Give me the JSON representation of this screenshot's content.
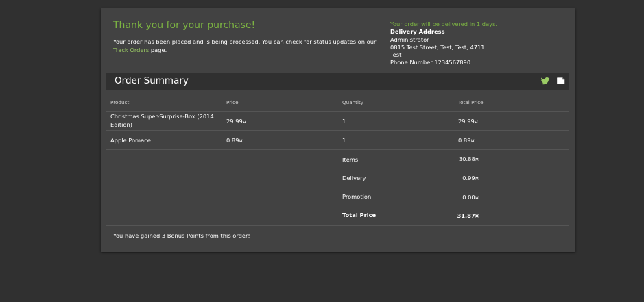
{
  "confirmation": {
    "title": "Thank you for your purchase!",
    "message_before": "Your order has been placed and is being processed. You can check for status updates on our ",
    "track_link": "Track Orders",
    "message_after": " page."
  },
  "delivery": {
    "eta": "Your order will be delivered in 1 days.",
    "address_title": "Delivery Address",
    "name": "Administrator",
    "street": "0815 Test Street, Test, Test, 4711",
    "country": "Test",
    "phone": "Phone Number 1234567890"
  },
  "summary": {
    "title": "Order Summary",
    "icons": [
      "twitter-icon",
      "print-icon"
    ],
    "colors": {
      "accent": "#7cb342",
      "link": "#9ccc65",
      "bar": "#303030",
      "card": "#424242"
    }
  },
  "table": {
    "headers": [
      "Product",
      "Price",
      "Quantity",
      "Total Price"
    ],
    "rows": [
      [
        "Christmas Super-Surprise-Box (2014 Edition)",
        "29.99¤",
        "1",
        "29.99¤"
      ],
      [
        "Apple Pomace",
        "0.89¤",
        "1",
        "0.89¤"
      ]
    ]
  },
  "totals": {
    "items_label": "Items",
    "items_value": "30.88¤",
    "delivery_label": "Delivery",
    "delivery_value": "0.99¤",
    "promotion_label": "Promotion",
    "promotion_value": "0.00¤",
    "total_label": "Total Price",
    "total_value": "31.87¤"
  },
  "bonus": "You have gained 3 Bonus Points from this order!"
}
